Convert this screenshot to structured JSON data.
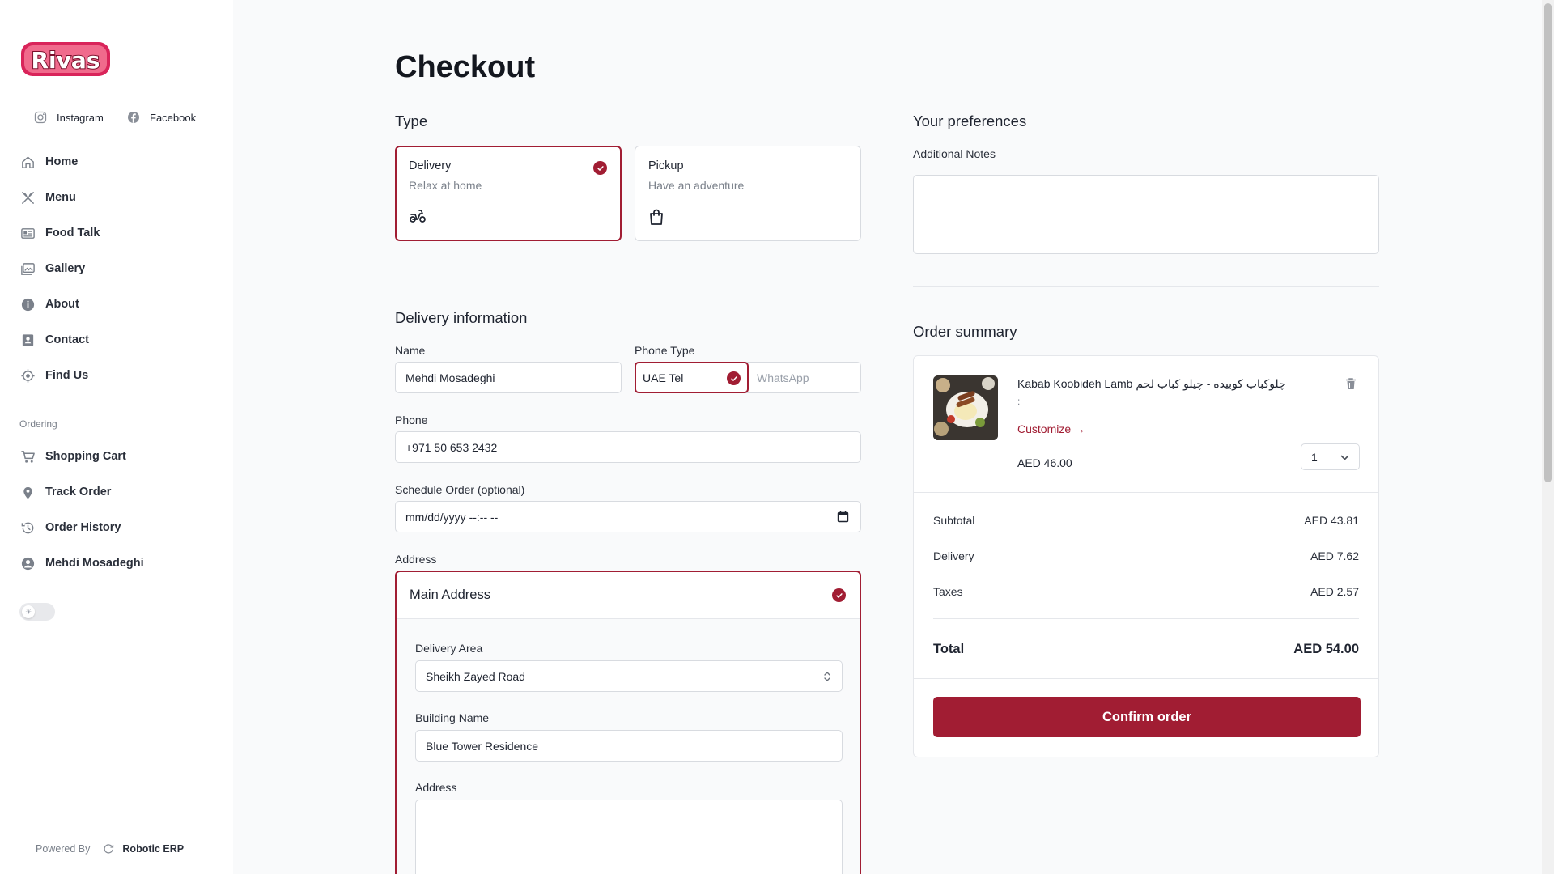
{
  "brand": {
    "logo_text": "Rivas"
  },
  "sidebar": {
    "social": [
      {
        "label": "Instagram",
        "icon": "instagram-icon"
      },
      {
        "label": "Facebook",
        "icon": "facebook-icon"
      }
    ],
    "nav": [
      {
        "label": "Home",
        "icon": "home-icon"
      },
      {
        "label": "Menu",
        "icon": "utensils-icon"
      },
      {
        "label": "Food Talk",
        "icon": "newspaper-icon"
      },
      {
        "label": "Gallery",
        "icon": "gallery-icon"
      },
      {
        "label": "About",
        "icon": "info-icon"
      },
      {
        "label": "Contact",
        "icon": "contact-card-icon"
      },
      {
        "label": "Find Us",
        "icon": "location-target-icon"
      }
    ],
    "ordering_label": "Ordering",
    "ordering": [
      {
        "label": "Shopping Cart",
        "icon": "cart-icon"
      },
      {
        "label": "Track Order",
        "icon": "map-pin-icon"
      },
      {
        "label": "Order History",
        "icon": "history-icon"
      },
      {
        "label": "Mehdi Mosadeghi",
        "icon": "user-circle-icon"
      }
    ],
    "theme_toggle": {
      "state": "light",
      "icon": "sun-icon"
    },
    "powered_by": "Powered By",
    "powered_brand": "Robotic ERP"
  },
  "checkout": {
    "title": "Checkout",
    "type_heading": "Type",
    "types": [
      {
        "title": "Delivery",
        "subtitle": "Relax at home",
        "icon": "scooter-icon",
        "selected": true
      },
      {
        "title": "Pickup",
        "subtitle": "Have an adventure",
        "icon": "shopping-bag-icon",
        "selected": false
      }
    ],
    "delivery_heading": "Delivery information",
    "name_label": "Name",
    "name_value": "Mehdi Mosadeghi",
    "phone_type_label": "Phone Type",
    "phone_types": [
      "UAE Tel",
      "WhatsApp"
    ],
    "phone_type_selected": "UAE Tel",
    "phone_label": "Phone",
    "phone_value": "+971 50 653 2432",
    "schedule_label": "Schedule Order (optional)",
    "schedule_placeholder": "mm/dd/yyyy --:-- --",
    "address_label": "Address",
    "address_card": {
      "title": "Main Address",
      "area_label": "Delivery Area",
      "area_value": "Sheikh Zayed Road",
      "building_label": "Building Name",
      "building_value": "Blue Tower Residence",
      "address_label": "Address",
      "address_value": ""
    }
  },
  "preferences": {
    "heading": "Your preferences",
    "notes_label": "Additional Notes",
    "notes_value": ""
  },
  "order_summary": {
    "heading": "Order summary",
    "item": {
      "name": "Kabab Koobideh Lamb چلوکباب کوبیده - چیلو کباب لحم",
      "sub": ":",
      "customize": "Customize",
      "price": "AED 46.00",
      "quantity": "1"
    },
    "subtotal_label": "Subtotal",
    "subtotal": "AED 43.81",
    "delivery_label": "Delivery",
    "delivery": "AED 7.62",
    "taxes_label": "Taxes",
    "taxes": "AED 2.57",
    "total_label": "Total",
    "total": "AED 54.00",
    "confirm_label": "Confirm order"
  },
  "colors": {
    "accent": "#a11d33",
    "sidebar_bg": "#ffffff",
    "main_bg": "#f9fafb"
  }
}
